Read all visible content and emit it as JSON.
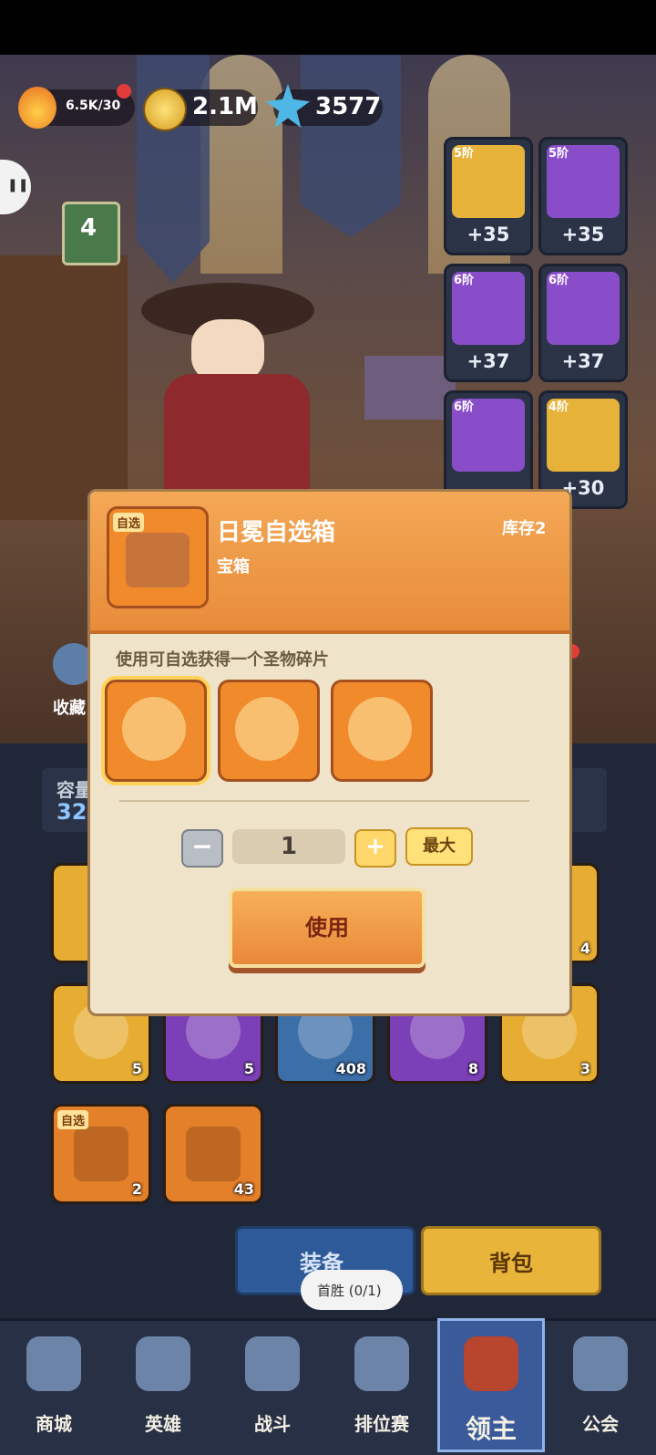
{
  "resources": {
    "stamina": "6.5K/30",
    "gold": "2.1M",
    "crystals": "3577"
  },
  "lord": {
    "level": "4"
  },
  "equipment": [
    {
      "tier": "5阶",
      "level": "+35",
      "rarity": "gold",
      "icon": "helmet-icon"
    },
    {
      "tier": "5阶",
      "level": "+35",
      "rarity": "purple",
      "icon": "chest-armor-icon"
    },
    {
      "tier": "6阶",
      "level": "+37",
      "rarity": "purple",
      "icon": "boots-icon"
    },
    {
      "tier": "6阶",
      "level": "+37",
      "rarity": "purple",
      "icon": "gloves-icon"
    },
    {
      "tier": "6阶",
      "level": "",
      "rarity": "purple",
      "icon": "cape-icon"
    },
    {
      "tier": "4阶",
      "level": "+30",
      "rarity": "gold",
      "icon": "pants-icon"
    }
  ],
  "side": {
    "favorites": "收藏"
  },
  "capacity": {
    "label": "容量",
    "value": "32"
  },
  "inventory": {
    "row1_partial": {
      "count": "4"
    },
    "row2": [
      {
        "icon": "leaf-fruit-icon",
        "count": "5",
        "rarity": "gold"
      },
      {
        "icon": "coconut-icon",
        "count": "5",
        "rarity": "purple"
      },
      {
        "icon": "potion-icon",
        "count": "408",
        "rarity": "blue"
      },
      {
        "icon": "moon-rune-icon",
        "count": "8",
        "rarity": "purple"
      },
      {
        "icon": "sun-rune-icon",
        "count": "3",
        "rarity": "gold"
      }
    ],
    "row3": [
      {
        "tag": "自选",
        "icon": "relic-chest-icon",
        "count": "2",
        "rarity": "orange"
      },
      {
        "icon": "feather-quill-icon",
        "count": "43",
        "rarity": "orange"
      }
    ]
  },
  "toggle": {
    "equip": "装备",
    "bag": "背包",
    "tooltip": "首胜 (0/1)"
  },
  "dialog": {
    "tag": "自选",
    "title": "日冕自选箱",
    "stock": "库存2",
    "category": "宝箱",
    "desc": "使用可自选获得一个圣物碎片",
    "choices": [
      "relic-shard-gold-icon",
      "relic-shard-purple-icon",
      "relic-shard-bow-icon"
    ],
    "quantity": "1",
    "max": "最大",
    "use": "使用"
  },
  "tabs": [
    {
      "label": "商城",
      "icon": "shop-icon"
    },
    {
      "label": "英雄",
      "icon": "hero-card-icon"
    },
    {
      "label": "战斗",
      "icon": "crossed-swords-icon"
    },
    {
      "label": "排位赛",
      "icon": "ranked-shield-icon"
    },
    {
      "label": "领主",
      "icon": "lord-banner-icon",
      "active": true
    },
    {
      "label": "公会",
      "icon": "guild-castle-icon"
    }
  ],
  "colors": {
    "accent_orange": "#ee8d36",
    "gold": "#e7b23a",
    "purple": "#8a4dc9",
    "panel": "#efe3c9"
  }
}
